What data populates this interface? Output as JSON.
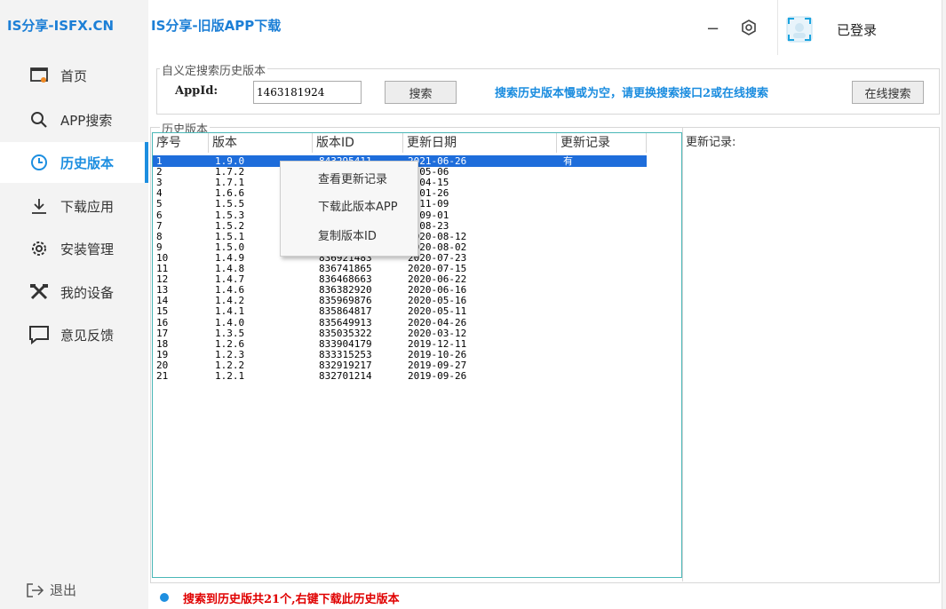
{
  "sidebar": {
    "brand": "IS分享-ISFX.CN",
    "items": [
      {
        "label": "首页",
        "icon": "home-icon"
      },
      {
        "label": "APP搜索",
        "icon": "search-icon"
      },
      {
        "label": "历史版本",
        "icon": "clock-icon",
        "active": true
      },
      {
        "label": "下载应用",
        "icon": "download-icon"
      },
      {
        "label": "安装管理",
        "icon": "install-icon"
      },
      {
        "label": "我的设备",
        "icon": "tools-icon"
      },
      {
        "label": "意见反馈",
        "icon": "feedback-icon"
      }
    ],
    "logout": "退出"
  },
  "header": {
    "title": "IS分享-旧版APP下载",
    "minimize": "−",
    "login_status": "已登录"
  },
  "search_group": {
    "legend": "自义定搜索历史版本",
    "appid_label": "AppId:",
    "appid_value": "1463181924",
    "search_button": "搜索",
    "hint": "搜索历史版本慢或为空，请更换搜索接口2或在线搜索",
    "online_button": "在线搜索"
  },
  "history_group": {
    "legend": "历史版本",
    "columns": [
      "序号",
      "版本",
      "版本ID",
      "更新日期",
      "更新记录"
    ],
    "rows": [
      [
        "1",
        "1.9.0",
        "843295411",
        "2021-06-26",
        "有"
      ],
      [
        "2",
        "1.7.2",
        "",
        "1-05-06",
        ""
      ],
      [
        "3",
        "1.7.1",
        "",
        "1-04-15",
        ""
      ],
      [
        "4",
        "1.6.6",
        "",
        "1-01-26",
        ""
      ],
      [
        "5",
        "1.5.5",
        "",
        "0-11-09",
        ""
      ],
      [
        "6",
        "1.5.3",
        "",
        "0-09-01",
        ""
      ],
      [
        "7",
        "1.5.2",
        "",
        "0-08-23",
        ""
      ],
      [
        "8",
        "1.5.1",
        "837265415",
        "2020-08-12",
        ""
      ],
      [
        "9",
        "1.5.0",
        "836995420",
        "2020-08-02",
        ""
      ],
      [
        "10",
        "1.4.9",
        "836921483",
        "2020-07-23",
        ""
      ],
      [
        "11",
        "1.4.8",
        "836741865",
        "2020-07-15",
        ""
      ],
      [
        "12",
        "1.4.7",
        "836468663",
        "2020-06-22",
        ""
      ],
      [
        "13",
        "1.4.6",
        "836382920",
        "2020-06-16",
        ""
      ],
      [
        "14",
        "1.4.2",
        "835969876",
        "2020-05-16",
        ""
      ],
      [
        "15",
        "1.4.1",
        "835864817",
        "2020-05-11",
        ""
      ],
      [
        "16",
        "1.4.0",
        "835649913",
        "2020-04-26",
        ""
      ],
      [
        "17",
        "1.3.5",
        "835035322",
        "2020-03-12",
        ""
      ],
      [
        "18",
        "1.2.6",
        "833904179",
        "2019-12-11",
        ""
      ],
      [
        "19",
        "1.2.3",
        "833315253",
        "2019-10-26",
        ""
      ],
      [
        "20",
        "1.2.2",
        "832919217",
        "2019-09-27",
        ""
      ],
      [
        "21",
        "1.2.1",
        "832701214",
        "2019-09-26",
        ""
      ]
    ]
  },
  "context_menu": {
    "items": [
      "查看更新记录",
      "下载此版本APP",
      "复制版本ID"
    ]
  },
  "update_record_label": "更新记录:",
  "status": {
    "text": "搜索到历史版共21个,右键下载此历史版本"
  },
  "colors": {
    "accent": "#1c8ee0",
    "list_border": "#4ab7b7",
    "selection": "#1e6ddb",
    "status_text": "#e00000"
  }
}
